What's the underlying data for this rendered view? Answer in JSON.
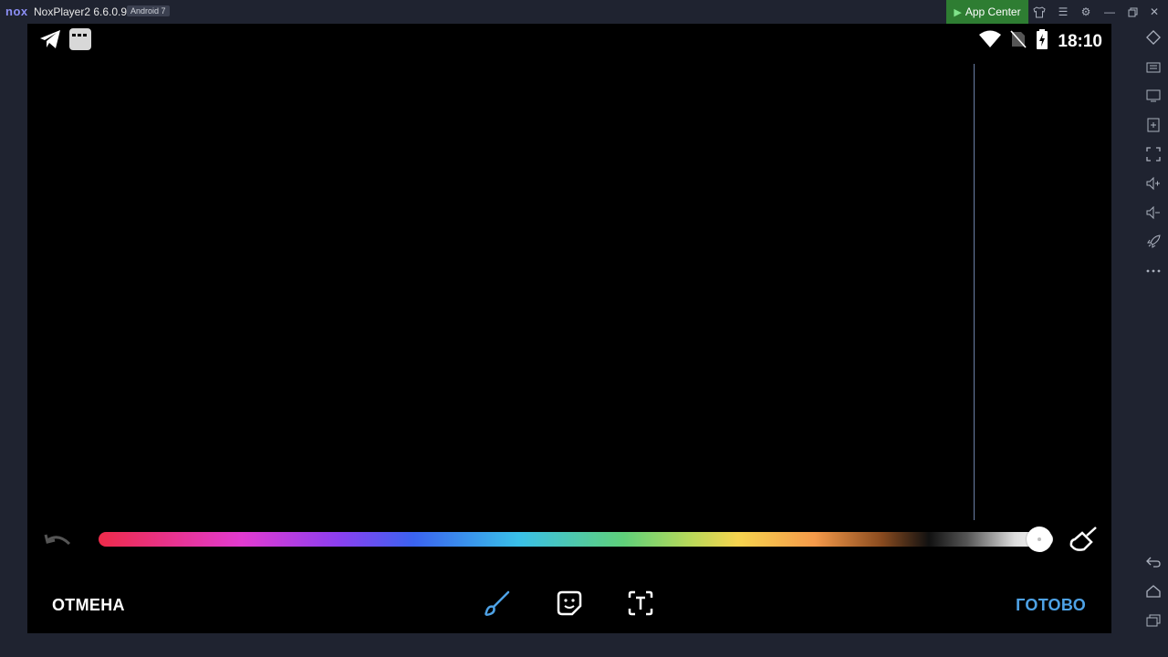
{
  "titlebar": {
    "logo": "nox",
    "title": "NoxPlayer2 6.6.0.9",
    "android_badge": "Android 7",
    "app_center": "App Center",
    "icons": [
      "shirt-icon",
      "menu-icon",
      "gear-icon",
      "minimize-icon",
      "restore-icon",
      "close-icon"
    ]
  },
  "status_bar": {
    "time": "18:10",
    "left_icons": [
      "telegram-icon",
      "notification-app-icon"
    ],
    "right_icons": [
      "wifi-icon",
      "no-sim-icon",
      "battery-charging-icon"
    ]
  },
  "editor": {
    "cancel_label": "ОТМЕНА",
    "done_label": "ГОТОВО",
    "accent_color": "#4ea2e6",
    "color_slider_position": 1.0,
    "tools": [
      "brush-icon",
      "sticker-icon",
      "text-icon"
    ],
    "active_tool": "brush-icon"
  },
  "sidebar": {
    "icons": [
      "rotate-icon",
      "keyboard-icon",
      "screen-record-icon",
      "add-apk-icon",
      "fullscreen-icon",
      "volume-up-icon",
      "volume-down-icon",
      "rocket-icon",
      "more-icon",
      "back-icon",
      "home-icon",
      "recent-apps-icon"
    ]
  }
}
